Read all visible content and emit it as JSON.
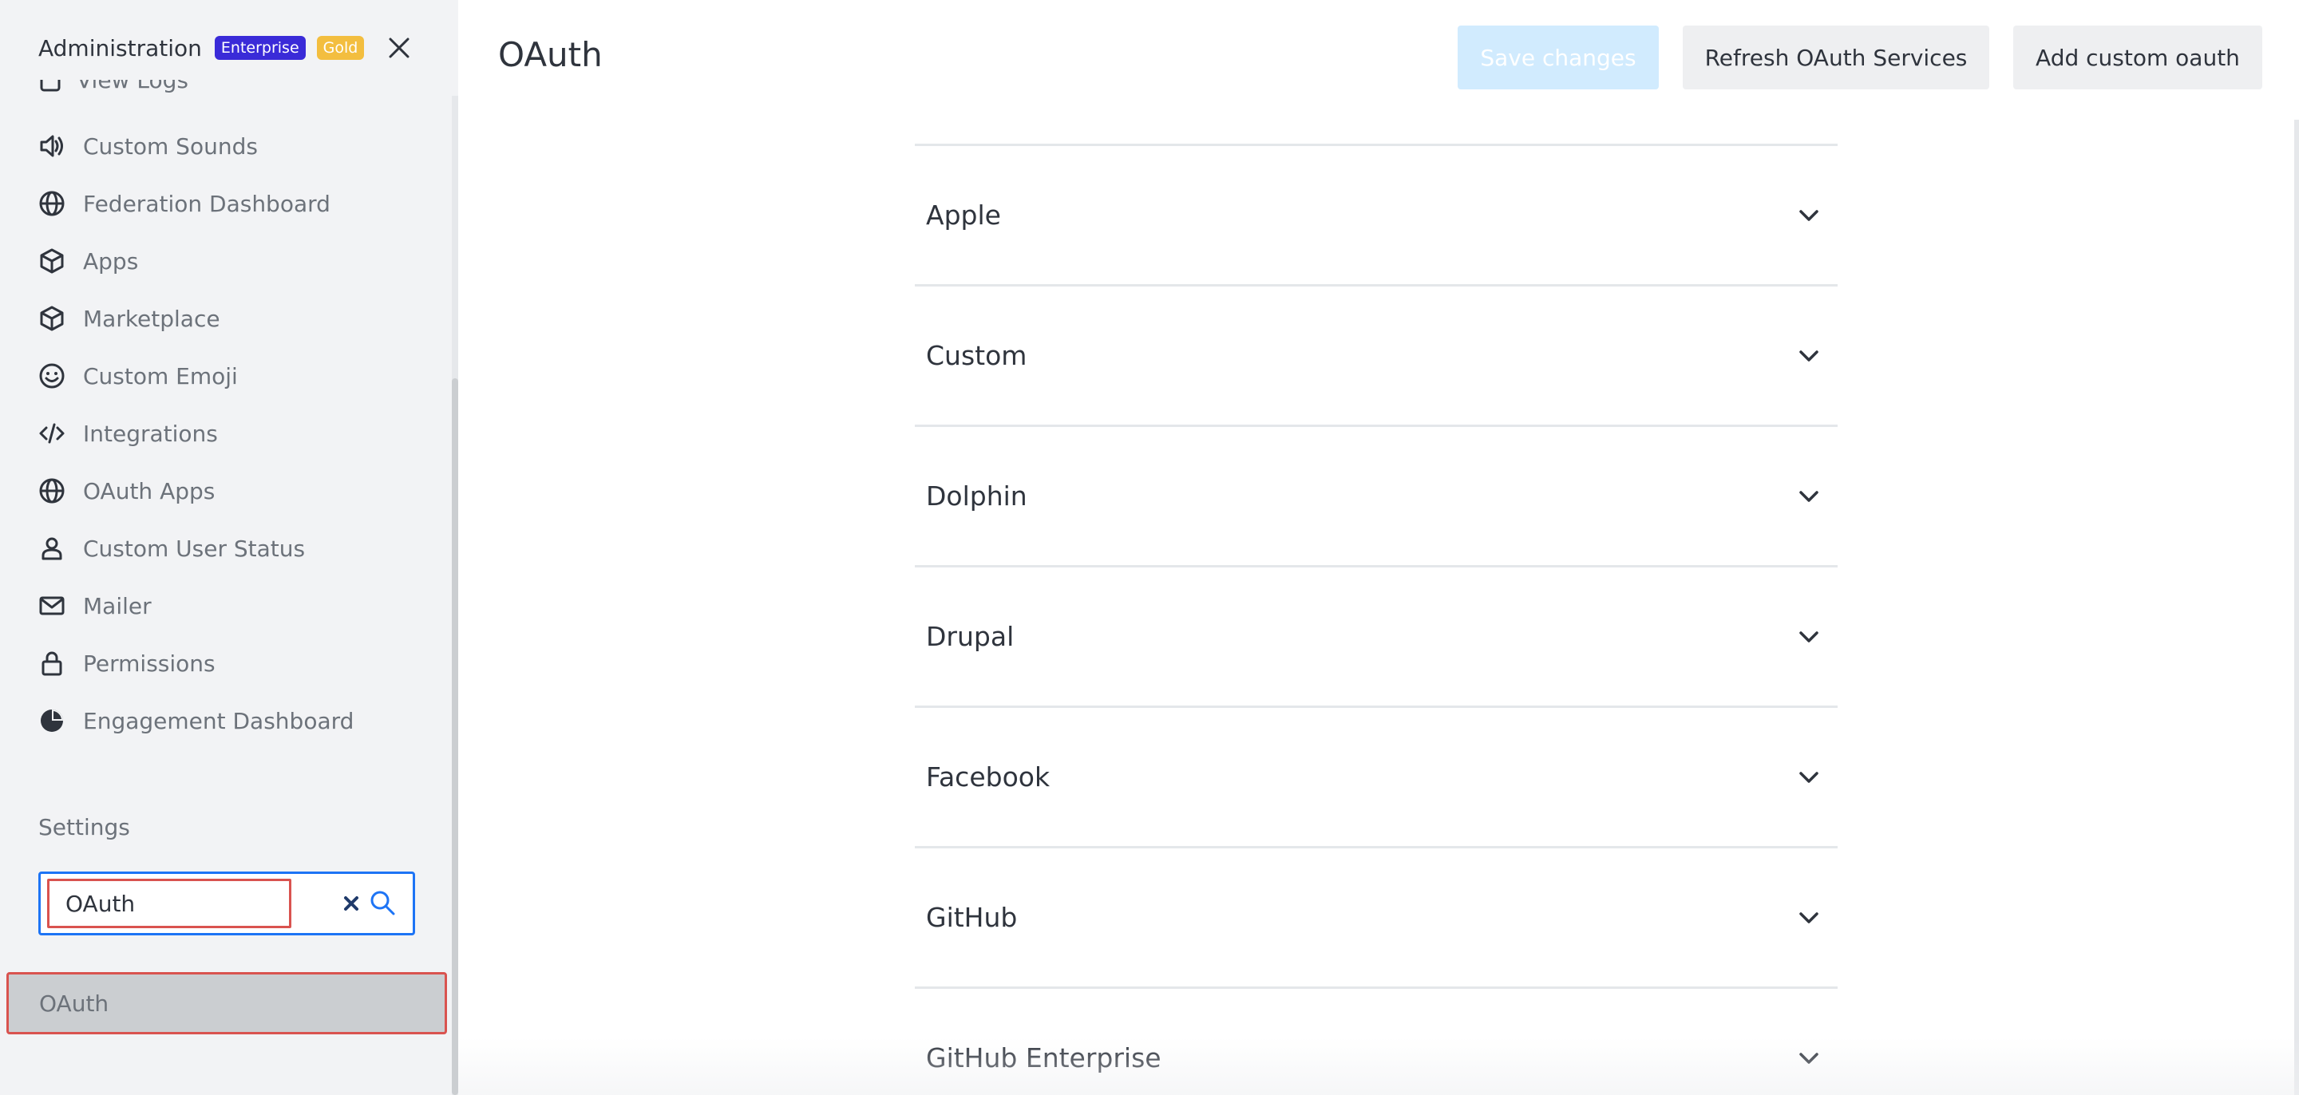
{
  "sidebar": {
    "title": "Administration",
    "badges": {
      "enterprise": "Enterprise",
      "gold": "Gold"
    },
    "partial_item": "View Logs",
    "items": [
      {
        "label": "Custom Sounds",
        "icon": "speaker-icon"
      },
      {
        "label": "Federation Dashboard",
        "icon": "globe-icon"
      },
      {
        "label": "Apps",
        "icon": "cube-icon"
      },
      {
        "label": "Marketplace",
        "icon": "cube-icon"
      },
      {
        "label": "Custom Emoji",
        "icon": "emoji-icon"
      },
      {
        "label": "Integrations",
        "icon": "code-icon"
      },
      {
        "label": "OAuth Apps",
        "icon": "globe-icon"
      },
      {
        "label": "Custom User Status",
        "icon": "user-icon"
      },
      {
        "label": "Mailer",
        "icon": "mail-icon"
      },
      {
        "label": "Permissions",
        "icon": "lock-icon"
      },
      {
        "label": "Engagement Dashboard",
        "icon": "pie-chart-icon"
      }
    ],
    "settings_label": "Settings",
    "search": {
      "value": "OAuth",
      "placeholder": ""
    },
    "result": "OAuth"
  },
  "main": {
    "title": "OAuth",
    "buttons": {
      "save": "Save changes",
      "refresh": "Refresh OAuth Services",
      "add_custom": "Add custom oauth"
    },
    "services": [
      "Apple",
      "Custom",
      "Dolphin",
      "Drupal",
      "Facebook",
      "GitHub",
      "GitHub Enterprise"
    ]
  },
  "colors": {
    "accent": "#1d74f5",
    "enterprise_badge": "#3a2bd8",
    "gold_badge": "#f3be3f",
    "highlight_border": "#d9534f",
    "sidebar_bg": "#f2f3f5",
    "disabled_button": "#d1ebfe"
  }
}
